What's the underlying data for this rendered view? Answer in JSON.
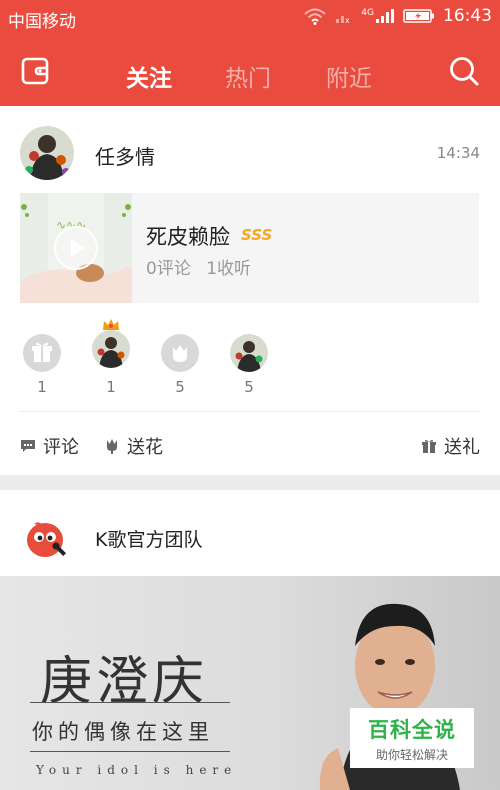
{
  "status_bar": {
    "carrier": "中国移动",
    "network": "4G",
    "time": "16:43"
  },
  "nav": {
    "tabs": [
      "关注",
      "热门",
      "附近"
    ],
    "active_tab": "关注",
    "accent_color": "#e94c3f",
    "left_icon": "wallet-icon",
    "right_icon": "search-icon"
  },
  "feed": {
    "post": {
      "username": "任多情",
      "time": "14:34",
      "song": {
        "title": "死皮赖脸",
        "badge": "SSS",
        "comments": "0评论",
        "listens": "1收听"
      },
      "gifts": [
        {
          "icon": "gift-icon",
          "count": "1"
        },
        {
          "icon": "crowned-avatar",
          "count": "1"
        },
        {
          "icon": "flower-icon",
          "count": "5"
        },
        {
          "icon": "avatar",
          "count": "5"
        }
      ],
      "actions": {
        "comment": "评论",
        "flower": "送花",
        "gift": "送礼"
      }
    },
    "official_post": {
      "username": "K歌官方团队",
      "banner": {
        "title": "庚澄庆",
        "subtitle": "你的偶像在这里",
        "english": "Your idol is here"
      }
    }
  },
  "watermark": {
    "title": "百科全说",
    "subtitle": "助你轻松解决"
  }
}
